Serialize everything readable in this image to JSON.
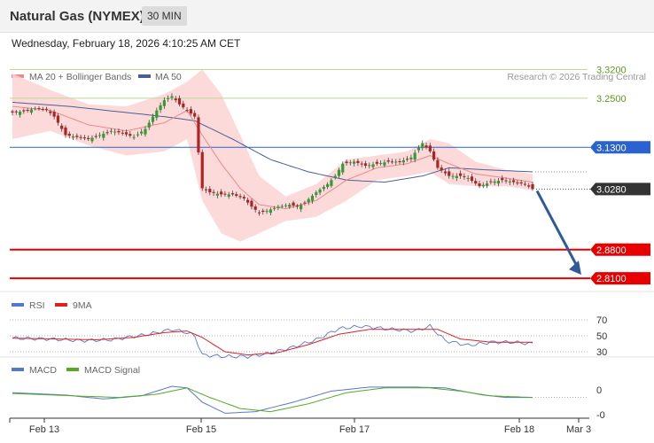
{
  "header": {
    "title": "Natural Gas (NYMEX)",
    "timeframe": "30 MIN",
    "datetime": "Wednesday, February 18, 2026 4:10:25 AM CET"
  },
  "colors": {
    "candle_up": "#2f9e2f",
    "candle_down": "#b22222",
    "ma20": "#ee8888",
    "band_fill": "#fbd3d3",
    "ma50": "#4a5f96",
    "resistance_green": "#bcd89a",
    "pivot_blue": "#2a63cf",
    "support_red": "#e80000",
    "last_price": "#333333",
    "arrow": "#2f5a9a",
    "rsi": "#5577cc",
    "rsi_ma": "#dd2222",
    "macd": "#5577cc",
    "macd_signal": "#55aa22"
  },
  "chart_data": [
    {
      "type": "candlestick",
      "legend": [
        "MA 20 + Bollinger Bands",
        "MA 50"
      ],
      "legend_placement": "top-left",
      "credit": "Research © 2026 Trading Central",
      "x_tick_labels": [
        "Feb 13",
        "Feb 15",
        "Feb 17",
        "Feb 18",
        "Mar 3"
      ],
      "ylim": [
        2.78,
        3.36
      ],
      "grid": false,
      "levels": [
        {
          "label": "3.3200",
          "value": 3.32,
          "kind": "resistance"
        },
        {
          "label": "3.2500",
          "value": 3.25,
          "kind": "resistance"
        },
        {
          "label": "3.1300",
          "value": 3.13,
          "kind": "pivot"
        },
        {
          "label": "3.0280",
          "value": 3.028,
          "kind": "last"
        },
        {
          "label": "2.8800",
          "value": 2.88,
          "kind": "support"
        },
        {
          "label": "2.8100",
          "value": 2.81,
          "kind": "support"
        }
      ],
      "price_path": [
        [
          0,
          3.215
        ],
        [
          3,
          3.218
        ],
        [
          6,
          3.225
        ],
        [
          9,
          3.222
        ],
        [
          11,
          3.205
        ],
        [
          14,
          3.16
        ],
        [
          17,
          3.155
        ],
        [
          20,
          3.15
        ],
        [
          23,
          3.16
        ],
        [
          26,
          3.17
        ],
        [
          29,
          3.165
        ],
        [
          32,
          3.155
        ],
        [
          35,
          3.175
        ],
        [
          38,
          3.22
        ],
        [
          40,
          3.245
        ],
        [
          42,
          3.255
        ],
        [
          44,
          3.235
        ],
        [
          46,
          3.22
        ],
        [
          48,
          3.205
        ],
        [
          50,
          3.03
        ],
        [
          52,
          3.02
        ],
        [
          55,
          3.015
        ],
        [
          58,
          3.015
        ],
        [
          61,
          3.005
        ],
        [
          63,
          2.985
        ],
        [
          65,
          2.97
        ],
        [
          67,
          2.975
        ],
        [
          70,
          2.985
        ],
        [
          73,
          2.99
        ],
        [
          75,
          2.985
        ],
        [
          77,
          2.995
        ],
        [
          80,
          3.02
        ],
        [
          83,
          3.04
        ],
        [
          85,
          3.06
        ],
        [
          87,
          3.09
        ],
        [
          90,
          3.095
        ],
        [
          93,
          3.085
        ],
        [
          96,
          3.09
        ],
        [
          99,
          3.095
        ],
        [
          102,
          3.095
        ],
        [
          105,
          3.105
        ],
        [
          108,
          3.14
        ],
        [
          110,
          3.12
        ],
        [
          112,
          3.08
        ],
        [
          115,
          3.06
        ],
        [
          118,
          3.06
        ],
        [
          120,
          3.055
        ],
        [
          123,
          3.035
        ],
        [
          126,
          3.045
        ],
        [
          129,
          3.05
        ],
        [
          132,
          3.045
        ],
        [
          135,
          3.04
        ],
        [
          137,
          3.028
        ]
      ],
      "ma20_path": [
        [
          0,
          3.23
        ],
        [
          10,
          3.22
        ],
        [
          20,
          3.185
        ],
        [
          30,
          3.17
        ],
        [
          40,
          3.19
        ],
        [
          46,
          3.22
        ],
        [
          50,
          3.16
        ],
        [
          55,
          3.09
        ],
        [
          60,
          3.03
        ],
        [
          65,
          2.99
        ],
        [
          72,
          2.98
        ],
        [
          80,
          3.0
        ],
        [
          88,
          3.05
        ],
        [
          96,
          3.08
        ],
        [
          104,
          3.09
        ],
        [
          110,
          3.11
        ],
        [
          115,
          3.09
        ],
        [
          122,
          3.065
        ],
        [
          130,
          3.055
        ],
        [
          137,
          3.045
        ]
      ],
      "bollinger_width_path": [
        [
          0,
          0.08
        ],
        [
          10,
          0.05
        ],
        [
          20,
          0.05
        ],
        [
          30,
          0.06
        ],
        [
          40,
          0.07
        ],
        [
          46,
          0.07
        ],
        [
          50,
          0.16
        ],
        [
          55,
          0.17
        ],
        [
          60,
          0.13
        ],
        [
          65,
          0.07
        ],
        [
          72,
          0.03
        ],
        [
          80,
          0.04
        ],
        [
          88,
          0.05
        ],
        [
          96,
          0.03
        ],
        [
          104,
          0.03
        ],
        [
          110,
          0.04
        ],
        [
          115,
          0.05
        ],
        [
          122,
          0.03
        ],
        [
          130,
          0.02
        ],
        [
          137,
          0.02
        ]
      ],
      "ma50_path": [
        [
          0,
          3.24
        ],
        [
          15,
          3.23
        ],
        [
          30,
          3.215
        ],
        [
          40,
          3.205
        ],
        [
          48,
          3.195
        ],
        [
          58,
          3.15
        ],
        [
          68,
          3.1
        ],
        [
          78,
          3.07
        ],
        [
          88,
          3.05
        ],
        [
          98,
          3.045
        ],
        [
          108,
          3.06
        ],
        [
          115,
          3.08
        ],
        [
          125,
          3.075
        ],
        [
          137,
          3.07
        ]
      ],
      "forecast": {
        "from": 3.028,
        "to": 2.81
      }
    },
    {
      "type": "line",
      "legend": [
        "RSI",
        "9MA"
      ],
      "legend_placement": "top-left",
      "y_tick_labels": [
        "70",
        "50",
        "30"
      ],
      "ylim": [
        20,
        80
      ],
      "rsi_path": [
        [
          0,
          47
        ],
        [
          10,
          46
        ],
        [
          18,
          44
        ],
        [
          26,
          45
        ],
        [
          36,
          52
        ],
        [
          42,
          58
        ],
        [
          46,
          54
        ],
        [
          48,
          50
        ],
        [
          50,
          26
        ],
        [
          56,
          24
        ],
        [
          62,
          24
        ],
        [
          68,
          28
        ],
        [
          74,
          36
        ],
        [
          80,
          45
        ],
        [
          86,
          59
        ],
        [
          92,
          62
        ],
        [
          100,
          58
        ],
        [
          106,
          56
        ],
        [
          110,
          62
        ],
        [
          114,
          44
        ],
        [
          120,
          38
        ],
        [
          126,
          42
        ],
        [
          132,
          42
        ],
        [
          137,
          40
        ]
      ],
      "ma9_path": [
        [
          0,
          47
        ],
        [
          12,
          46
        ],
        [
          22,
          45
        ],
        [
          32,
          48
        ],
        [
          40,
          54
        ],
        [
          46,
          56
        ],
        [
          50,
          48
        ],
        [
          56,
          30
        ],
        [
          62,
          26
        ],
        [
          70,
          29
        ],
        [
          78,
          39
        ],
        [
          86,
          52
        ],
        [
          94,
          58
        ],
        [
          104,
          58
        ],
        [
          112,
          58
        ],
        [
          118,
          46
        ],
        [
          126,
          42
        ],
        [
          137,
          42
        ]
      ]
    },
    {
      "type": "line",
      "legend": [
        "MACD",
        "MACD Signal"
      ],
      "legend_placement": "top-left",
      "y_tick_labels": [
        "0",
        "-0"
      ],
      "ylim": [
        -0.03,
        0.017
      ],
      "macd_path": [
        [
          0,
          0.0
        ],
        [
          14,
          -0.003
        ],
        [
          24,
          -0.008
        ],
        [
          34,
          -0.004
        ],
        [
          42,
          0.008
        ],
        [
          46,
          0.006
        ],
        [
          50,
          -0.012
        ],
        [
          56,
          -0.026
        ],
        [
          64,
          -0.024
        ],
        [
          74,
          -0.012
        ],
        [
          84,
          0.002
        ],
        [
          94,
          0.007
        ],
        [
          106,
          0.007
        ],
        [
          114,
          0.006
        ],
        [
          124,
          -0.003
        ],
        [
          130,
          -0.006
        ],
        [
          137,
          -0.006
        ]
      ],
      "signal_path": [
        [
          0,
          -0.001
        ],
        [
          16,
          -0.004
        ],
        [
          28,
          -0.006
        ],
        [
          38,
          -0.002
        ],
        [
          46,
          0.006
        ],
        [
          52,
          -0.006
        ],
        [
          60,
          -0.02
        ],
        [
          68,
          -0.024
        ],
        [
          78,
          -0.014
        ],
        [
          88,
          0.0
        ],
        [
          98,
          0.006
        ],
        [
          110,
          0.006
        ],
        [
          118,
          0.002
        ],
        [
          126,
          -0.004
        ],
        [
          137,
          -0.006
        ]
      ]
    }
  ]
}
